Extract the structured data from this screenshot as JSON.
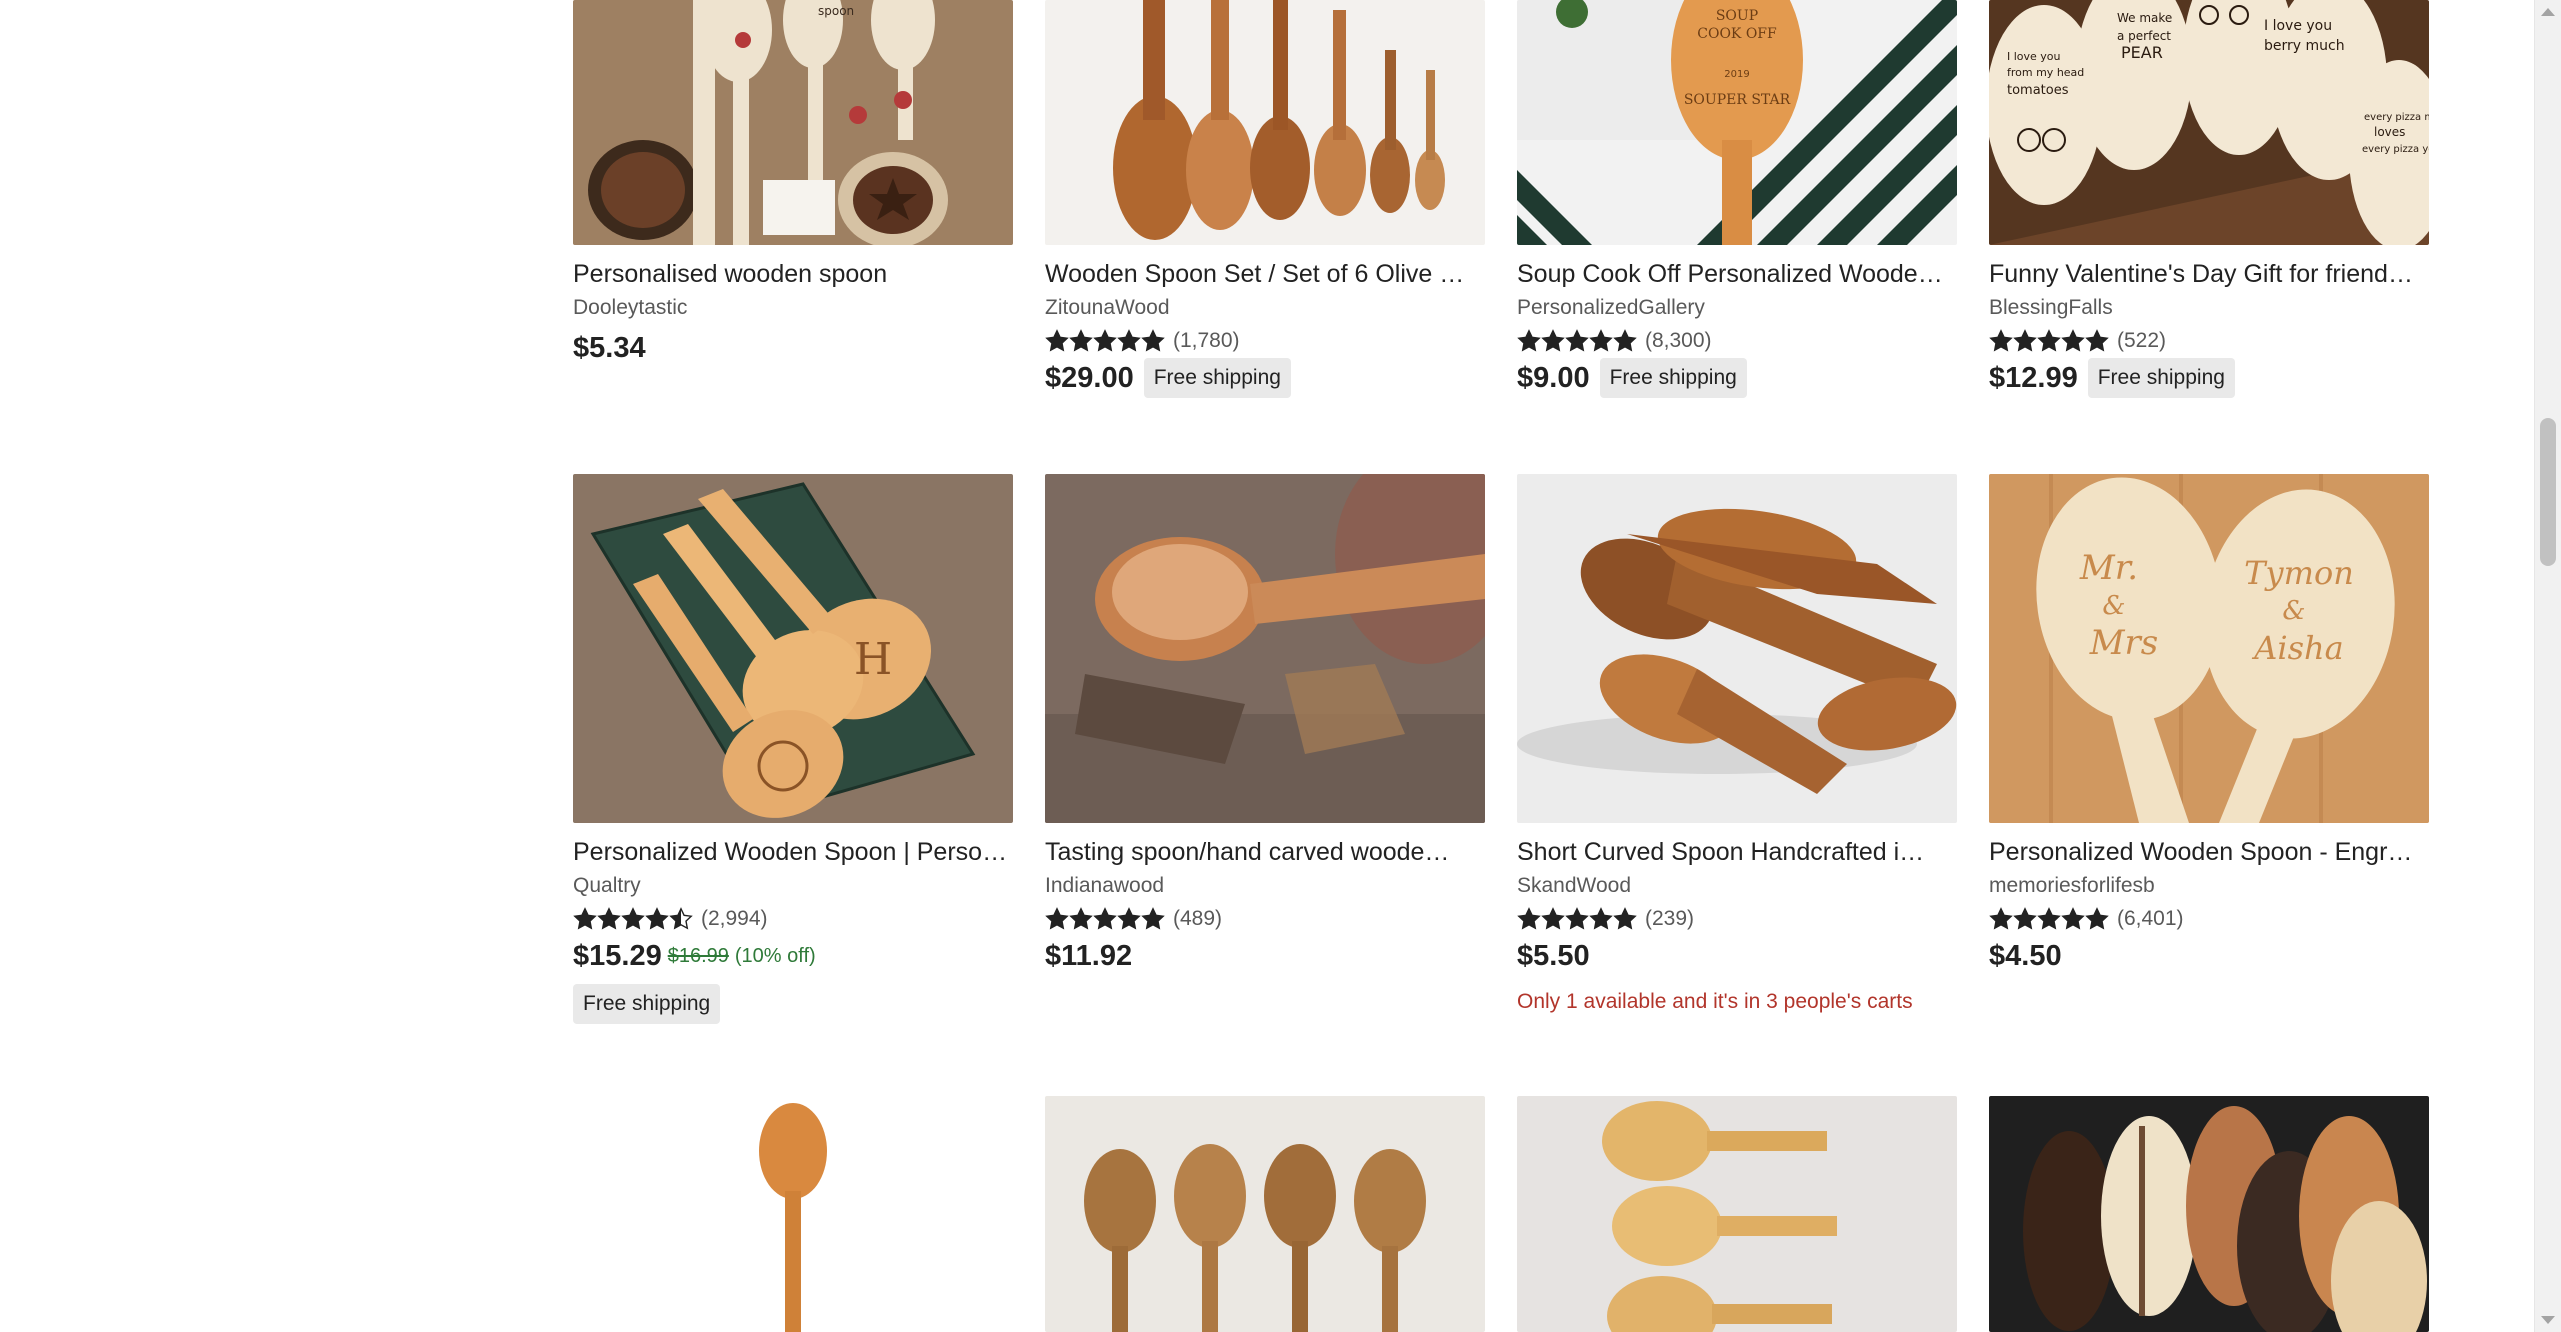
{
  "listings": [
    {
      "title": "Personalised wooden spoon",
      "shop": "Dooleytastic",
      "price": "$5.34"
    },
    {
      "title": "Wooden Spoon Set / Set of 6 Olive …",
      "shop": "ZitounaWood",
      "stars": 5,
      "reviews": "(1,780)",
      "price": "$29.00",
      "badge": "Free shipping"
    },
    {
      "title": "Soup Cook Off Personalized Woode…",
      "shop": "PersonalizedGallery",
      "stars": 5,
      "reviews": "(8,300)",
      "price": "$9.00",
      "badge": "Free shipping"
    },
    {
      "title": "Funny Valentine's Day Gift for friend…",
      "shop": "BlessingFalls",
      "stars": 5,
      "reviews": "(522)",
      "price": "$12.99",
      "badge": "Free shipping"
    },
    {
      "title": "Personalized Wooden Spoon | Perso…",
      "shop": "Qualtry",
      "stars": 4.5,
      "reviews": "(2,994)",
      "price": "$15.29",
      "original_price": "$16.99",
      "discount": "(10% off)",
      "badge": "Free shipping"
    },
    {
      "title": "Tasting spoon/hand carved woode…",
      "shop": "Indianawood",
      "stars": 5,
      "reviews": "(489)",
      "price": "$11.92"
    },
    {
      "title": "Short Curved Spoon Handcrafted i…",
      "shop": "SkandWood",
      "stars": 5,
      "reviews": "(239)",
      "price": "$5.50",
      "scarcity": "Only 1 available and it's in 3 people's carts"
    },
    {
      "title": "Personalized Wooden Spoon - Engr…",
      "shop": "memoriesforlifesb",
      "stars": 5,
      "reviews": "(6,401)",
      "price": "$4.50"
    },
    {},
    {},
    {},
    {}
  ],
  "images": {
    "r1_top_text": [
      "spoon",
      "SOUP",
      "COOK OFF",
      "2019",
      "SOUPER STAR",
      "We make",
      "a perfect",
      "PEAR",
      "I love you",
      "berry much",
      "I love you",
      "from my head",
      "tomatoes",
      "every pizza me",
      "loves",
      "every pizza you"
    ],
    "r2_engraved": [
      "Mr.",
      "&",
      "Mrs",
      "Tymon",
      "&",
      "Aisha"
    ]
  },
  "colors": {
    "scarcity": "#b2352b",
    "discount": "#2f7a39",
    "badge_bg": "#e9e9e9"
  }
}
